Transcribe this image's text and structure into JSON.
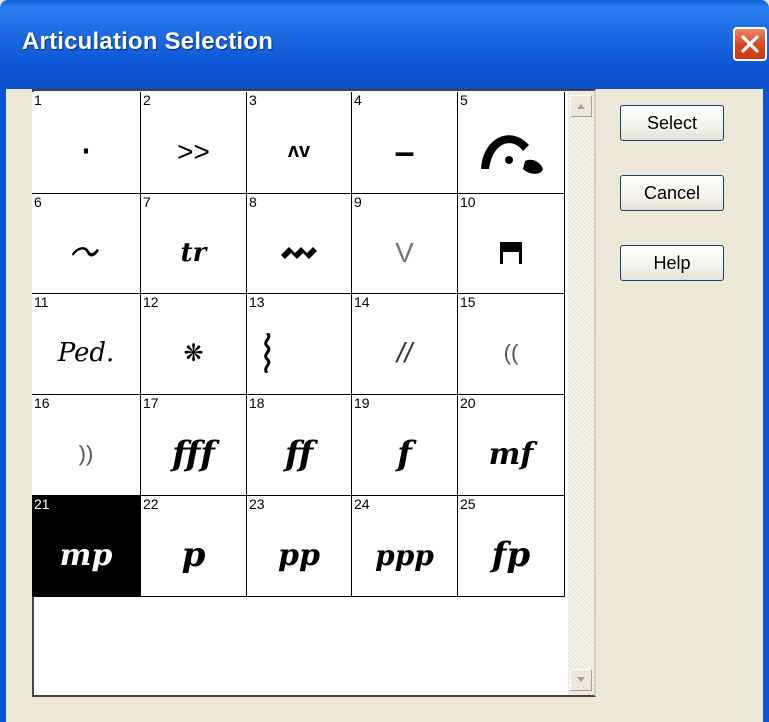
{
  "window": {
    "title": "Articulation Selection"
  },
  "buttons": {
    "select": "Select",
    "cancel": "Cancel",
    "help": "Help"
  },
  "cells": [
    {
      "n": "1",
      "sym": "·"
    },
    {
      "n": "2",
      "sym": ">>"
    },
    {
      "n": "3",
      "sym": "ʌv"
    },
    {
      "n": "4",
      "sym": "–"
    },
    {
      "n": "5",
      "sym": "fermata-icon"
    },
    {
      "n": "6",
      "sym": "turn-icon"
    },
    {
      "n": "7",
      "sym": "tr"
    },
    {
      "n": "8",
      "sym": "mordent-icon"
    },
    {
      "n": "9",
      "sym": "V"
    },
    {
      "n": "10",
      "sym": "flag-icon"
    },
    {
      "n": "11",
      "sym": "Ped."
    },
    {
      "n": "12",
      "sym": "❋"
    },
    {
      "n": "13",
      "sym": "arpeggio-icon"
    },
    {
      "n": "14",
      "sym": "//"
    },
    {
      "n": "15",
      "sym": "(("
    },
    {
      "n": "16",
      "sym": "))"
    },
    {
      "n": "17",
      "sym": "fff"
    },
    {
      "n": "18",
      "sym": "ff"
    },
    {
      "n": "19",
      "sym": "f"
    },
    {
      "n": "20",
      "sym": "mf"
    },
    {
      "n": "21",
      "sym": "mp",
      "selected": true
    },
    {
      "n": "22",
      "sym": "p"
    },
    {
      "n": "23",
      "sym": "pp"
    },
    {
      "n": "24",
      "sym": "ppp"
    },
    {
      "n": "25",
      "sym": "fp"
    }
  ],
  "colors": {
    "title_bar": "#0b55d4",
    "selected_cell": "#000000",
    "dialog_bg": "#ece9d8",
    "close_button": "#d9431f"
  }
}
